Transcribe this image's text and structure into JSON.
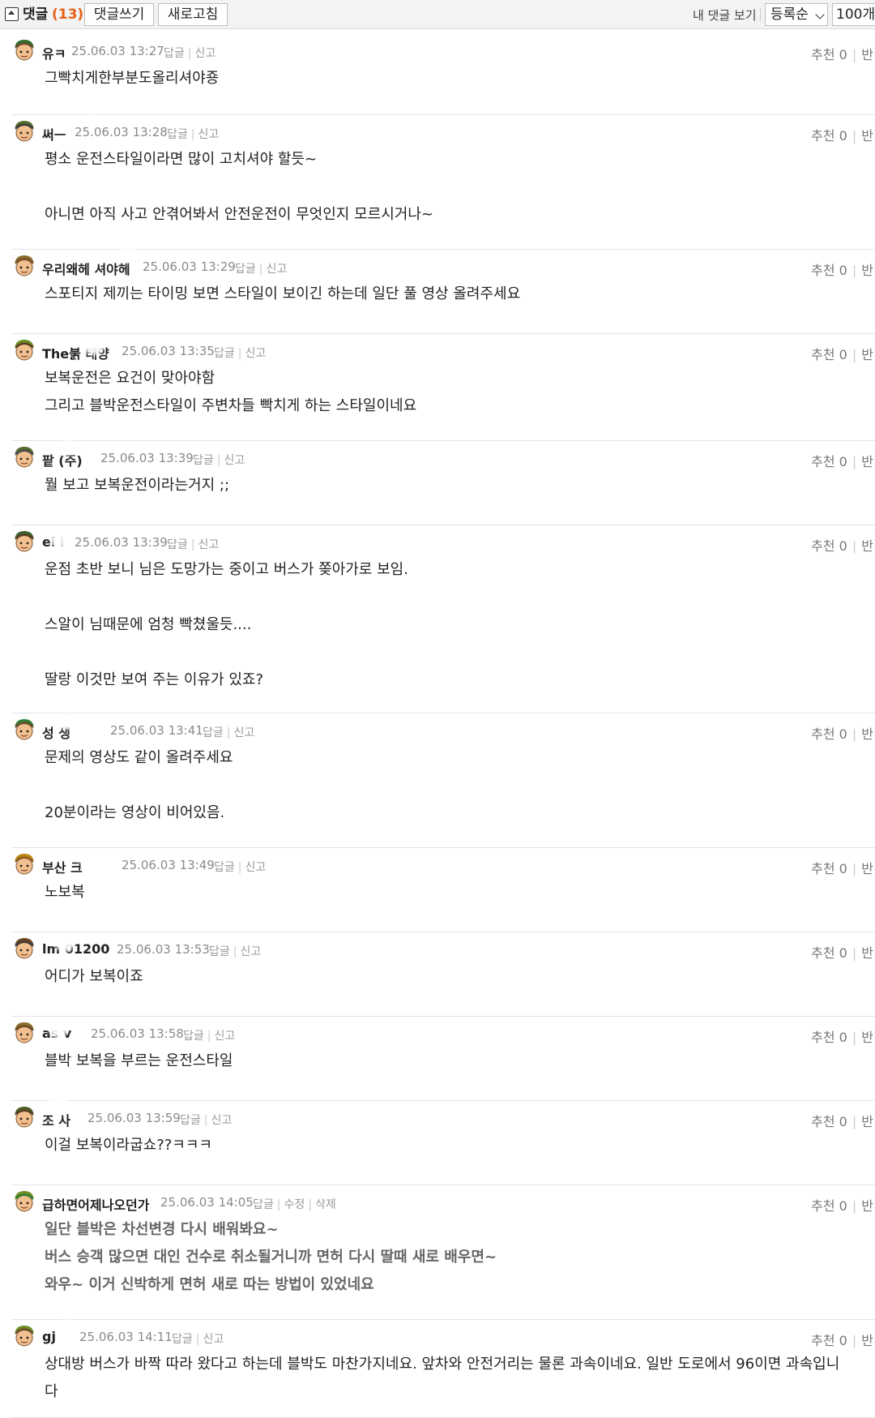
{
  "toolbar": {
    "comments_title": "댓글",
    "comments_count": "(13)",
    "write_label": "댓글쓰기",
    "refresh_label": "새로고침",
    "my_comments_label": "내 댓글 보기",
    "sort_selected": "등록순",
    "pagesize_selected": "100개"
  },
  "comments": [
    {
      "nick": "유ㅋ",
      "date": "25.06.03 13:27",
      "reply": "답글",
      "report": "신고",
      "vote": "추천 0",
      "down": "반",
      "lines": [
        "그빡치게한부분도올리셔야죵"
      ]
    },
    {
      "nick": "써ㅡ",
      "date": "25.06.03 13:28",
      "reply": "답글",
      "report": "신고",
      "vote": "추천 0",
      "down": "반",
      "lines": [
        "평소 운전스타일이라면 많이 고치셔야 할듯~",
        "",
        "아니면 아직 사고 안겪어봐서 안전운전이 무엇인지 모르시거나~"
      ]
    },
    {
      "nick": "우리왜헤  셔야헤",
      "date": "25.06.03 13:29",
      "reply": "답글",
      "report": "신고",
      "vote": "추천 0",
      "down": "반",
      "lines": [
        "스포티지 제끼는 타이밍 보면 스타일이 보이긴 하는데 일단 풀 영상 올려주세요"
      ]
    },
    {
      "nick": "The붉 태양",
      "date": "25.06.03 13:35",
      "reply": "답글",
      "report": "신고",
      "vote": "추천 0",
      "down": "반",
      "lines": [
        "보복운전은 요건이 맞아야함",
        "그리고 블박운전스타일이 주변차들 빡치게 하는 스타일이네요"
      ]
    },
    {
      "nick": "팥 (주)",
      "date": "25.06.03 13:39",
      "reply": "답글",
      "report": "신고",
      "vote": "추천 0",
      "down": "반",
      "lines": [
        "뭘 보고 보복운전이라는거지 ;;"
      ]
    },
    {
      "nick": "ei i",
      "date": "25.06.03 13:39",
      "reply": "답글",
      "report": "신고",
      "vote": "추천 0",
      "down": "반",
      "lines": [
        "운점 초반 보니 님은 도망가는 중이고 버스가 쫒아가로 보임.",
        "",
        "스알이 님때문에 엄청 빡쳤울듯....",
        "",
        "딸랑 이것만 보여 주는 이유가 있죠?"
      ]
    },
    {
      "nick": "성 생",
      "date": "25.06.03 13:41",
      "reply": "답글",
      "report": "신고",
      "vote": "추천 0",
      "down": "반",
      "lines": [
        "문제의 영상도 같이 올려주세요",
        "",
        "20분이라는 영상이 비어있음."
      ]
    },
    {
      "nick": "부산 크",
      "date": "25.06.03 13:49",
      "reply": "답글",
      "report": "신고",
      "vote": "추천 0",
      "down": "반",
      "lines": [
        "노보복"
      ]
    },
    {
      "nick": "lm 01200",
      "date": "25.06.03 13:53",
      "reply": "답글",
      "report": "신고",
      "vote": "추천 0",
      "down": "반",
      "lines": [
        "어디가 보복이죠"
      ]
    },
    {
      "nick": "as v",
      "date": "25.06.03 13:58",
      "reply": "답글",
      "report": "신고",
      "vote": "추천 0",
      "down": "반",
      "lines": [
        "블박 보복을 부르는 운전스타일"
      ]
    },
    {
      "nick": "조 사",
      "date": "25.06.03 13:59",
      "reply": "답글",
      "report": "신고",
      "vote": "추천 0",
      "down": "반",
      "lines": [
        "이걸 보복이라굽쇼??ㅋㅋㅋ"
      ]
    },
    {
      "nick": "급하면어제나오던가",
      "date": "25.06.03 14:05",
      "reply": "답글",
      "edit": "수정",
      "delete": "삭제",
      "vote": "추천 0",
      "down": "반",
      "self": true,
      "lines": [
        "일단 블박은 차선변경 다시 배워봐요~",
        "버스 승객 많으면 대인 건수로 취소될거니까 면허 다시 딸때 새로 배우면~",
        "와우~ 이거 신박하게 면허 새로 따는 방법이 있었네요"
      ]
    },
    {
      "nick": "gj",
      "date": "25.06.03 14:11",
      "reply": "답글",
      "report": "신고",
      "vote": "추천 0",
      "down": "반",
      "lines": [
        "상대방 버스가 바짝 따라 왔다고 하는데 블박도 마찬가지네요. 앞차와 안전거리는 물론 과속이네요. 일반 도로에서 96이면 과속입니",
        "다"
      ]
    }
  ]
}
